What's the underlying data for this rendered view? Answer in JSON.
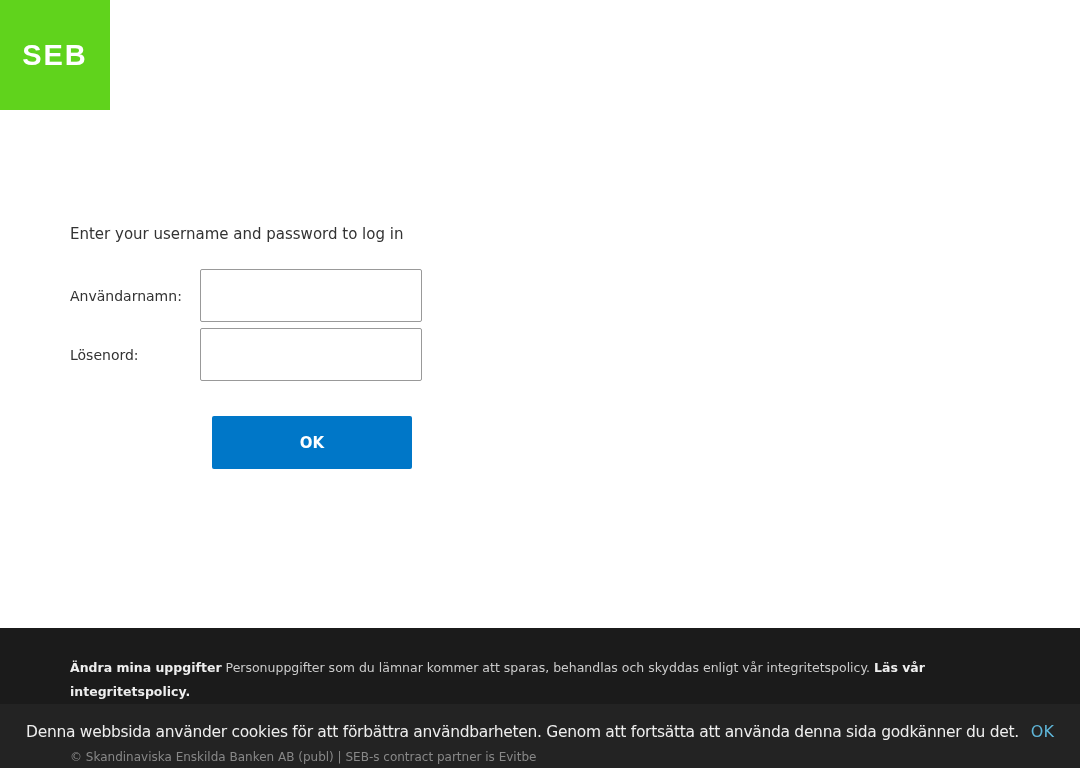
{
  "logo": {
    "text": "SEB"
  },
  "login": {
    "instruction": "Enter your username and password to log in",
    "fields": [
      {
        "label": "Användarnamn:"
      },
      {
        "label": "Lösenord:"
      }
    ],
    "submit": "OK"
  },
  "footer": {
    "privacy": "**Ändra mina uppgifter**  Personuppgifter som du lämnar kommer att sparas, behandlas och skyddas enligt vår integritetspolicy. **Läs vår integritetspolicy.**",
    "copyright": "© Skandinaviska Enskilda Banken AB (publ) | SEB-s contract partner is Evitbe"
  },
  "cookie_banner": {
    "message": "Denna webbsida använder cookies för att förbättra användbarheten. Genom att fortsätta att använda denna sida godkänner du det.",
    "accept": "OK"
  }
}
